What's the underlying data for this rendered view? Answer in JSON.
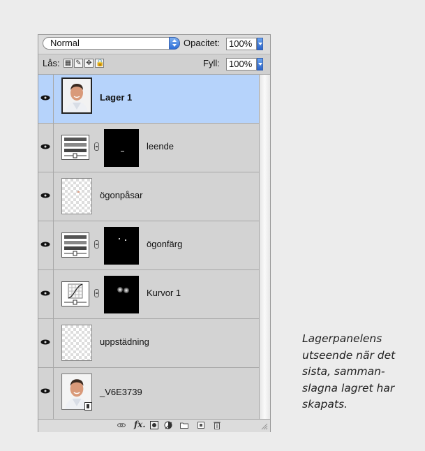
{
  "blend_mode": "Normal",
  "opacity_label": "Opacitet:",
  "opacity_value": "100%",
  "lock_label": "Lås:",
  "fill_label": "Fyll:",
  "fill_value": "100%",
  "layers": [
    {
      "name": "Lager 1",
      "selected": true
    },
    {
      "name": "leende"
    },
    {
      "name": "ögonpåsar"
    },
    {
      "name": "ögonfärg"
    },
    {
      "name": "Kurvor 1"
    },
    {
      "name": "uppstädning"
    },
    {
      "name": "_V6E3739"
    }
  ],
  "caption_lines": [
    "Lagerpanelens",
    "utseende när det",
    "sista, samman-",
    "slagna lagret har",
    "skapats."
  ]
}
